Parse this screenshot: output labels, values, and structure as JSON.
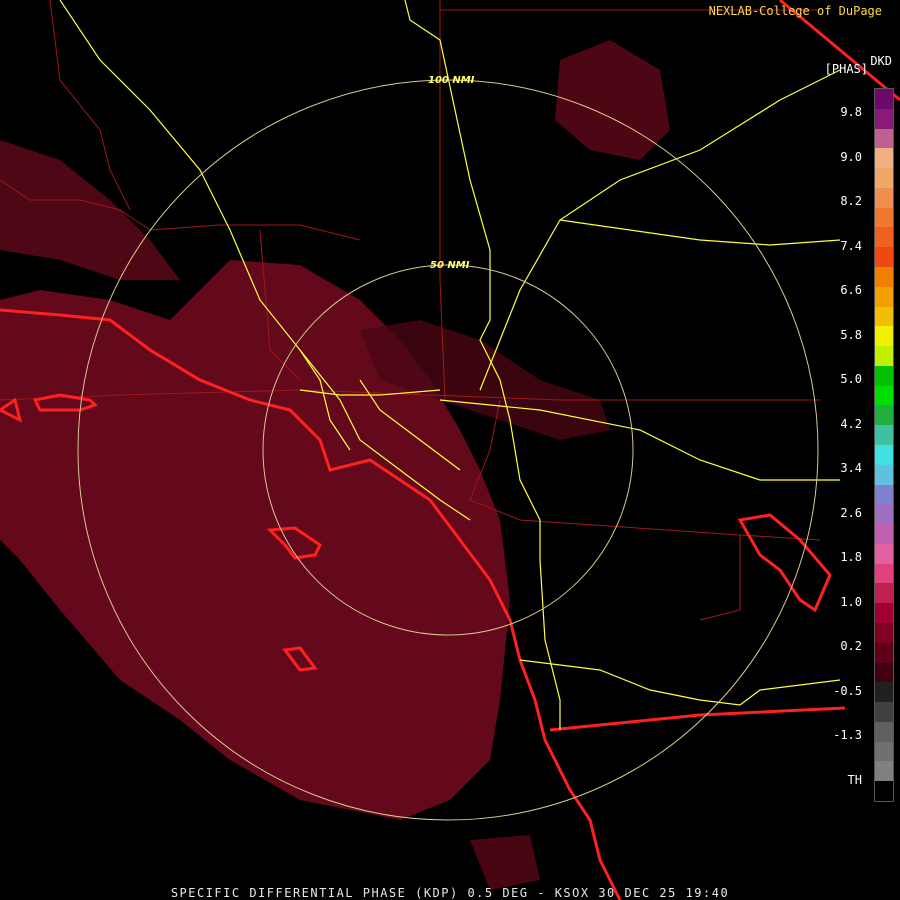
{
  "credit": "NEXLAB-College of DuPage",
  "product_code": "DKD",
  "units": "[PHAS]",
  "footer": "SPECIFIC DIFFERENTIAL PHASE (KDP) 0.5 DEG - KSOX 30 DEC 25 19:40",
  "range_rings": [
    "100 NMI",
    "50 NMI"
  ],
  "colorbar": {
    "ticks": [
      "9.8",
      "9.0",
      "8.2",
      "7.4",
      "6.6",
      "5.8",
      "5.0",
      "4.2",
      "3.4",
      "2.6",
      "1.8",
      "1.0",
      "0.2",
      "-0.5",
      "-1.3",
      "TH"
    ],
    "colors": [
      "#6a0a6a",
      "#8a1a7a",
      "#c06090",
      "#f0b080",
      "#f0a868",
      "#f09050",
      "#f07830",
      "#f06020",
      "#f04810",
      "#f08000",
      "#f0a000",
      "#f0c000",
      "#f0f000",
      "#c0f000",
      "#00c000",
      "#00e000",
      "#20b040",
      "#40c0a0",
      "#40e0e0",
      "#60c0e0",
      "#8080d0",
      "#a070c0",
      "#c060b0",
      "#e060a0",
      "#e04080",
      "#c02050",
      "#a00030",
      "#800020",
      "#600018",
      "#400010",
      "#202020",
      "#404040",
      "#606060",
      "#707070",
      "#808080",
      "#000000"
    ]
  }
}
